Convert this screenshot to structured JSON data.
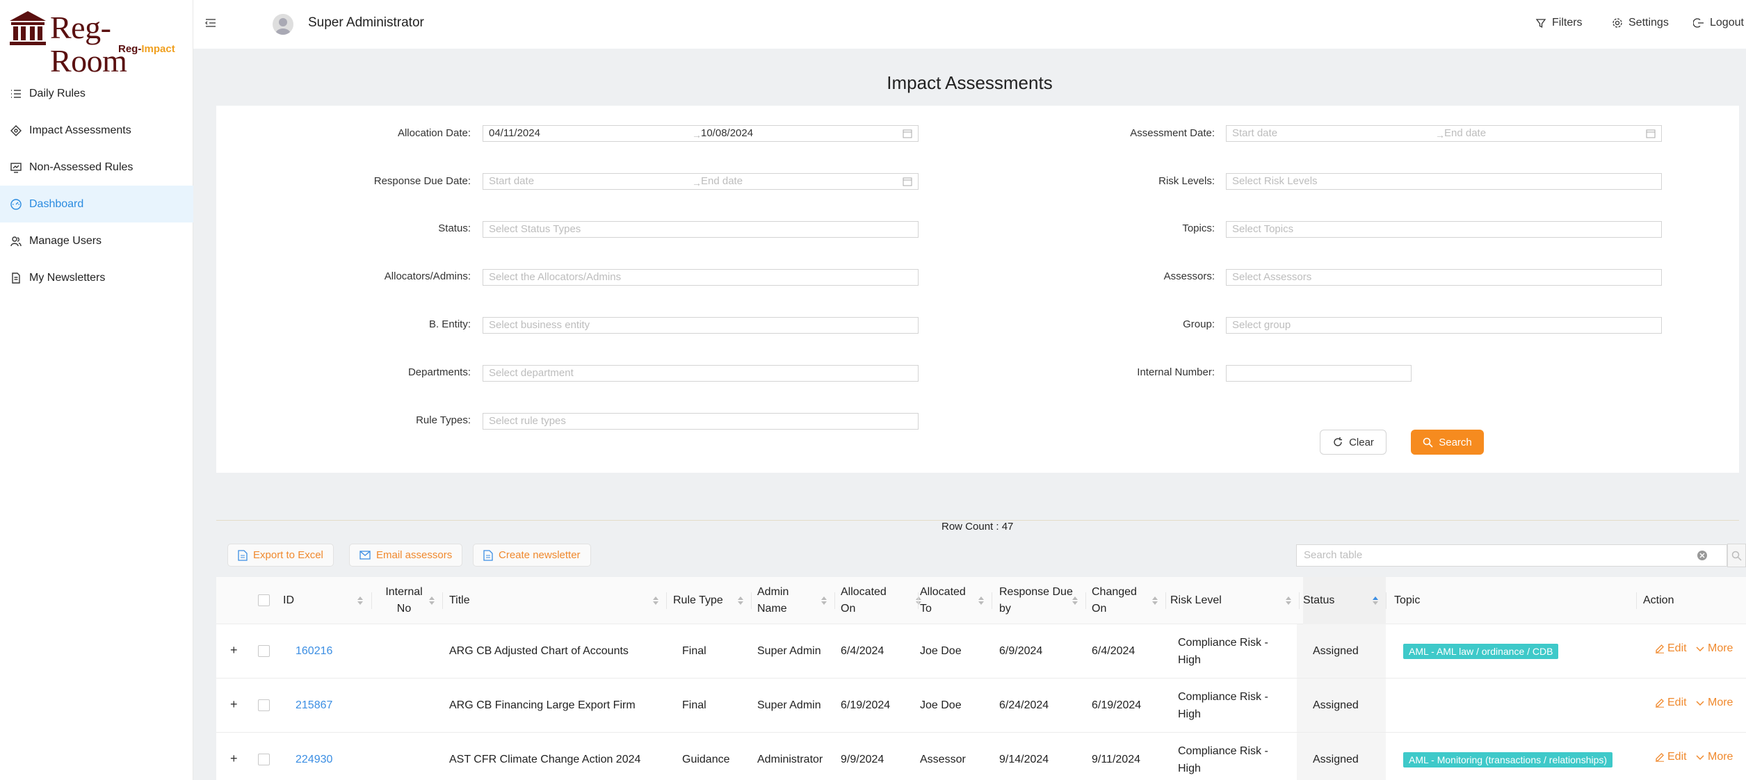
{
  "app": {
    "logo_main": "Reg-Room",
    "logo_sub_a": "Reg-",
    "logo_sub_b": "Impact"
  },
  "sidebar": {
    "items": [
      {
        "label": "Daily Rules",
        "icon": "list-icon"
      },
      {
        "label": "Impact Assessments",
        "icon": "diamond-icon"
      },
      {
        "label": "Non-Assessed Rules",
        "icon": "monitor-icon"
      },
      {
        "label": "Dashboard",
        "icon": "dashboard-icon",
        "active": true
      },
      {
        "label": "Manage Users",
        "icon": "users-icon"
      },
      {
        "label": "My Newsletters",
        "icon": "document-icon"
      }
    ]
  },
  "header": {
    "user": "Super Administrator",
    "filters": "Filters",
    "settings": "Settings",
    "logout": "Logout"
  },
  "page": {
    "title": "Impact Assessments"
  },
  "filters": {
    "allocation_date": {
      "label": "Allocation Date:",
      "start": "04/11/2024",
      "end": "10/08/2024"
    },
    "response_due_date": {
      "label": "Response Due Date:",
      "start_placeholder": "Start date",
      "end_placeholder": "End date"
    },
    "status": {
      "label": "Status:",
      "placeholder": "Select Status Types"
    },
    "allocators": {
      "label": "Allocators/Admins:",
      "placeholder": "Select the Allocators/Admins"
    },
    "entity": {
      "label": "B. Entity:",
      "placeholder": "Select business entity"
    },
    "departments": {
      "label": "Departments:",
      "placeholder": "Select department"
    },
    "rule_types": {
      "label": "Rule Types:",
      "placeholder": "Select rule types"
    },
    "assessment_date": {
      "label": "Assessment Date:",
      "start_placeholder": "Start date",
      "end_placeholder": "End date"
    },
    "risk_levels": {
      "label": "Risk Levels:",
      "placeholder": "Select Risk Levels"
    },
    "topics": {
      "label": "Topics:",
      "placeholder": "Select Topics"
    },
    "assessors": {
      "label": "Assessors:",
      "placeholder": "Select Assessors"
    },
    "group": {
      "label": "Group:",
      "placeholder": "Select group"
    },
    "internal_number": {
      "label": "Internal Number:",
      "value": ""
    },
    "clear": "Clear",
    "search": "Search"
  },
  "table_bar": {
    "row_count": "Row Count : 47",
    "export": "Export to Excel",
    "email": "Email assessors",
    "newsletter": "Create newsletter",
    "search_placeholder": "Search table"
  },
  "table": {
    "headers": {
      "id": "ID",
      "internal_a": "Internal",
      "internal_b": "No",
      "title": "Title",
      "rule_type": "Rule Type",
      "admin_a": "Admin",
      "admin_b": "Name",
      "alloc_on_a": "Allocated",
      "alloc_on_b": "On",
      "alloc_to_a": "Allocated",
      "alloc_to_b": "To",
      "due_a": "Response Due",
      "due_b": "by",
      "changed_a": "Changed",
      "changed_b": "On",
      "risk": "Risk Level",
      "status": "Status",
      "topic": "Topic",
      "action": "Action"
    },
    "rows": [
      {
        "id": "160216",
        "internal": "",
        "title": "ARG CB Adjusted Chart of Accounts",
        "rule_type": "Final",
        "admin": "Super Admin",
        "allocated_on": "6/4/2024",
        "allocated_to": "Joe Doe",
        "due": "6/9/2024",
        "changed": "6/4/2024",
        "risk_a": "Compliance Risk -",
        "risk_b": "High",
        "status": "Assigned",
        "topic": "AML - AML law / ordinance / CDB",
        "edit": "Edit",
        "more": "More"
      },
      {
        "id": "215867",
        "internal": "",
        "title": "ARG CB Financing Large Export Firm",
        "rule_type": "Final",
        "admin": "Super Admin",
        "allocated_on": "6/19/2024",
        "allocated_to": "Joe Doe",
        "due": "6/24/2024",
        "changed": "6/19/2024",
        "risk_a": "Compliance Risk -",
        "risk_b": "High",
        "status": "Assigned",
        "topic": "",
        "edit": "Edit",
        "more": "More"
      },
      {
        "id": "224930",
        "internal": "",
        "title": "AST CFR Climate Change Action 2024",
        "rule_type": "Guidance",
        "admin": "Administrator",
        "allocated_on": "9/9/2024",
        "allocated_to": "Assessor",
        "due": "9/14/2024",
        "changed": "9/11/2024",
        "risk_a": "Compliance Risk -",
        "risk_b": "High",
        "status": "Assigned",
        "topic": "AML - Monitoring (transactions / relationships)",
        "edit": "Edit",
        "more": "More"
      }
    ]
  },
  "colors": {
    "accent": "#f68b1f",
    "link": "#3b8ee3",
    "tag": "#3ec9c9",
    "brand": "#5a1010"
  }
}
